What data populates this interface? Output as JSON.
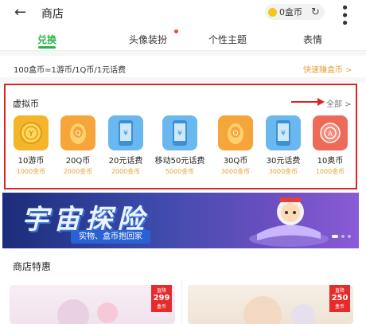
{
  "header": {
    "back_icon": "←",
    "title": "商店",
    "coin_label": "0盒币",
    "refresh_icon": "↻",
    "more_icon": "⋮"
  },
  "tabs": [
    {
      "label": "兑换",
      "active": true
    },
    {
      "label": "头像装扮",
      "has_dot": true
    },
    {
      "label": "个性主题"
    },
    {
      "label": "表情"
    }
  ],
  "rate": {
    "text": "100盒币=1游币/1Q币/1元话费",
    "link": "快速赚盒币 >"
  },
  "virtual": {
    "title": "虚拟币",
    "all_label": "全部 >",
    "items": [
      {
        "name": "10游币",
        "price": "1000金币",
        "icon": "coin-icon",
        "color": "#f5b52a"
      },
      {
        "name": "20Q币",
        "price": "2000金币",
        "icon": "qq-penguin-icon",
        "color": "#f5a53a"
      },
      {
        "name": "20元话费",
        "price": "2000金币",
        "icon": "phone-icon",
        "color": "#6ab8f0"
      },
      {
        "name": "移动50元话费",
        "price": "5000金币",
        "icon": "phone-icon",
        "color": "#6ab8f0"
      },
      {
        "name": "30Q币",
        "price": "3000金币",
        "icon": "qq-penguin-icon",
        "color": "#f5a53a"
      },
      {
        "name": "30元话费",
        "price": "3000金币",
        "icon": "phone-icon",
        "color": "#6ab8f0"
      },
      {
        "name": "10奥币",
        "price": "1000金币",
        "icon": "ao-coin-icon",
        "color": "#ee6a58"
      }
    ]
  },
  "banner": {
    "title": "宇宙探险",
    "subtitle": "实物、盒币抱回家"
  },
  "specials": {
    "title": "商店特惠",
    "cards": [
      {
        "badge_top": "直降",
        "badge_value": "299",
        "badge_unit": "盒币"
      },
      {
        "badge_top": "直降",
        "badge_value": "250",
        "badge_unit": "盒币"
      }
    ]
  }
}
